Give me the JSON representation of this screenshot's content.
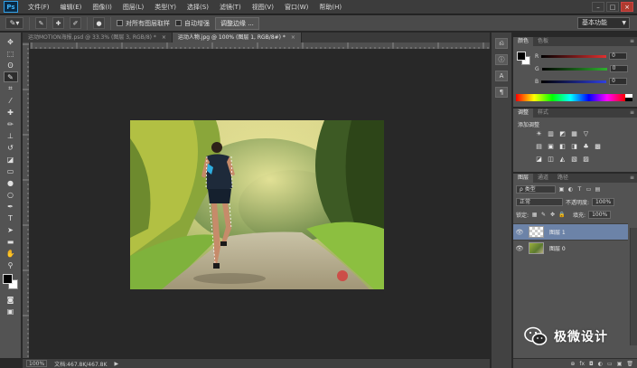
{
  "app": {
    "logo": "Ps"
  },
  "menu": [
    "文件(F)",
    "编辑(E)",
    "图像(I)",
    "图层(L)",
    "类型(Y)",
    "选择(S)",
    "滤镜(T)",
    "视图(V)",
    "窗口(W)",
    "帮助(H)"
  ],
  "window_controls": [
    "–",
    "□",
    "×"
  ],
  "options_bar": {
    "sample_all_layers": "对所有图层取样",
    "auto_enhance": "自动增强",
    "refine_edge": "调整边缘 ...",
    "workspace": "基本功能"
  },
  "doc_tabs": [
    {
      "label": "运动MOTION海报.psd @ 33.3% (图层 3, RGB/8) *",
      "active": false
    },
    {
      "label": "运动人物.jpg @ 100% (图层 1, RGB/8#) *",
      "active": true
    }
  ],
  "status_bar": {
    "zoom": "100%",
    "doc_size": "文档:467.8K/467.8K"
  },
  "color_panel": {
    "tabs": [
      "颜色",
      "色板"
    ],
    "channels": [
      {
        "label": "R",
        "value": "0",
        "color": "#e03030"
      },
      {
        "label": "G",
        "value": "0",
        "color": "#30b030"
      },
      {
        "label": "B",
        "value": "0",
        "color": "#3040e0"
      }
    ]
  },
  "adjust_panel": {
    "tabs": [
      "调整",
      "样式"
    ],
    "title": "添加调整",
    "row1": [
      "☀",
      "▥",
      "◩",
      "▦",
      "▽"
    ],
    "row2": [
      "▤",
      "▣",
      "◧",
      "◨",
      "♣",
      "▩"
    ],
    "row3": [
      "◪",
      "◫",
      "◭",
      "▧",
      "▨"
    ]
  },
  "layers_panel": {
    "tabs": [
      "图层",
      "通道",
      "路径"
    ],
    "filter": "ρ 类型",
    "blend_mode": "正常",
    "opacity_label": "不透明度:",
    "opacity": "100%",
    "lock_label": "锁定:",
    "fill_label": "填充:",
    "fill": "100%",
    "layers": [
      {
        "name": "图层 1",
        "selected": true
      },
      {
        "name": "图层 0",
        "selected": false
      }
    ],
    "footer": [
      "⊕",
      "fx",
      "◘",
      "◐",
      "▭",
      "▣",
      "🗑"
    ]
  },
  "watermark": {
    "text": "极微设计"
  }
}
